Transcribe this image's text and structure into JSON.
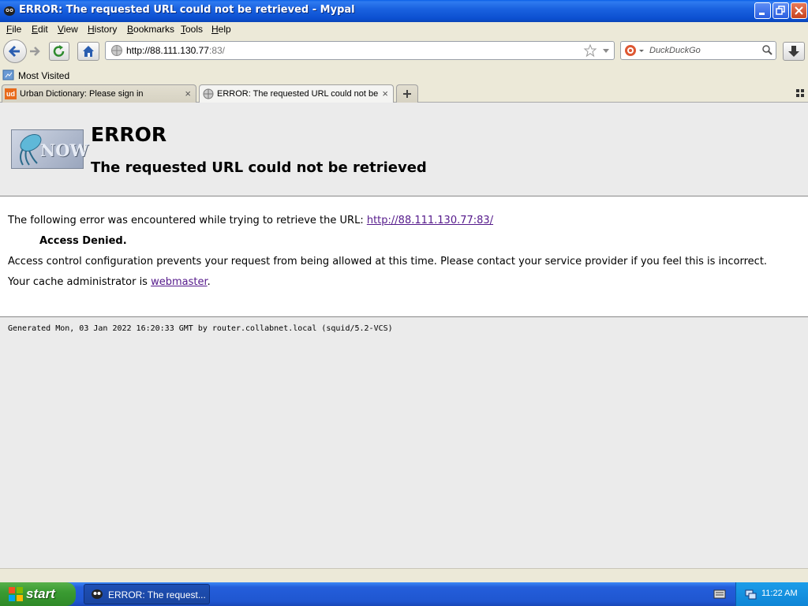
{
  "window": {
    "title": "ERROR: The requested URL could not be retrieved - Mypal"
  },
  "menu": [
    "File",
    "Edit",
    "View",
    "History",
    "Bookmarks",
    "Tools",
    "Help"
  ],
  "nav": {
    "url_host": "http://88.111.130.77",
    "url_port": ":83/",
    "search_placeholder": "DuckDuckGo"
  },
  "bookmarks": {
    "most_visited": "Most Visited"
  },
  "tabs": [
    {
      "label": "Urban Dictionary: Please sign in",
      "favicon": "ud"
    },
    {
      "label": "ERROR: The requested URL could not be..."
    }
  ],
  "page": {
    "logo_text": "NOW",
    "heading": "ERROR",
    "subheading": "The requested URL could not be retrieved",
    "line1_text": "The following error was encountered while trying to retrieve the URL: ",
    "line1_link": "http://88.111.130.77:83/",
    "denied": "Access Denied.",
    "line3": "Access control configuration prevents your request from being allowed at this time. Please contact your service provider if you feel this is incorrect.",
    "line4_text": "Your cache administrator is ",
    "line4_link": "webmaster",
    "line4_end": ".",
    "footer": "Generated Mon, 03 Jan 2022 16:20:33 GMT by router.collabnet.local (squid/5.2-VCS)"
  },
  "taskbar": {
    "start": "start",
    "task_label": "ERROR: The request...",
    "clock": "11:22 AM"
  }
}
